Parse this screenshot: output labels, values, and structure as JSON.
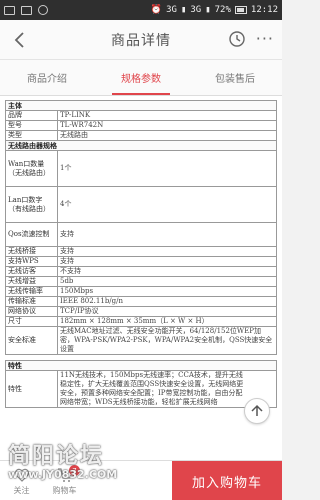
{
  "status_bar": {
    "network_1": "3G",
    "network_2": "3G",
    "battery": "72%",
    "time": "12:12"
  },
  "header": {
    "title": "商品详情",
    "back": "back-arrow",
    "history": "clock-icon",
    "more": "···"
  },
  "tabs": [
    {
      "label": "商品介绍",
      "active": false
    },
    {
      "label": "规格参数",
      "active": true
    },
    {
      "label": "包装售后",
      "active": false
    }
  ],
  "spec": {
    "section_main": "主体",
    "brand_k": "品牌",
    "brand_v": "TP-LINK",
    "model_k": "型号",
    "model_v": "TL-WR742N",
    "type_k": "类型",
    "type_v": "无线路由",
    "section_router": "无线路由器规格",
    "wan_k": "Wan口数量（无线路由）",
    "wan_v": "1个",
    "lan_k": "Lan口数字（有线路由）",
    "lan_v": "4个",
    "qos_k": "Qos流速控制",
    "qos_v": "支持",
    "bridge_k": "无线桥接",
    "bridge_v": "支持",
    "wps_k": "支持WPS",
    "wps_v": "支持",
    "guest_k": "无线访客",
    "guest_v": "不支持",
    "mode_k": "天线增益",
    "mode_v": "5db",
    "rate_k": "无线传输率",
    "rate_v": "150Mbps",
    "std_k": "传输标准",
    "std_v": "IEEE 802.11b/g/n",
    "proto_k": "网络协议",
    "proto_v": "TCP/IP协议",
    "size_k": "尺寸",
    "size_v": "182mm × 128mm × 35mm（L × W × H）",
    "sec_k": "安全标准",
    "sec_v": "无线MAC地址过滤、无线安全功能开关，64/128/152位WEP加密，WPA-PSK/WPA2-PSK，WPA/WPA2安全机制，QSS快速安全设置",
    "section_feature": "特性",
    "feat_k": "特性",
    "feat_v": "11N无线技术，150Mbps无线速率；CCA技术，提升无线稳定性，扩大无线覆盖范围QSS快速安全设置，无线网络更安全，预置多种网络安全配置；IP带宽控制功能，自由分配网络带宽；WDS无线桥接功能，轻松扩展无线网络"
  },
  "bottom_bar": {
    "item1_label": "关注",
    "item2_label": "购物车",
    "cart_badge": "7",
    "add_to_cart": "加入购物车"
  },
  "watermark": {
    "main": "简阳论坛",
    "url": "www.JY0832.COM"
  },
  "colors": {
    "accent": "#e0454b",
    "status_bar": "#2f2f2f"
  }
}
